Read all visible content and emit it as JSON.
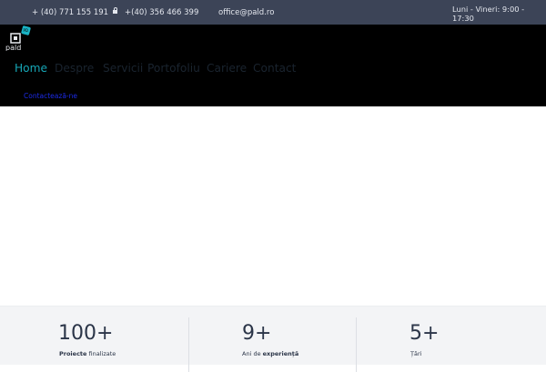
{
  "topbar": {
    "phone1": "+ (40) 771 155 191",
    "phone2": "+(40) 356 466 399",
    "email": "office@pald.ro",
    "hours": "Luni - Vineri: 9:00 - 17:30",
    "lock_icon": "lock-icon"
  },
  "logo": {
    "text": "pald",
    "icon": "chip-icon"
  },
  "nav": {
    "items": [
      {
        "label": "Home",
        "active": true
      },
      {
        "label": "Despre"
      },
      {
        "label": "Servicii"
      },
      {
        "label": "Portofoliu"
      },
      {
        "label": "Cariere"
      },
      {
        "label": "Contact"
      }
    ],
    "contact_link": "Contactează-ne"
  },
  "stats": [
    {
      "number": "100+",
      "label_bold": "Proiecte",
      "label_rest": " finalizate"
    },
    {
      "number": "9+",
      "label_pre": "Ani de ",
      "label_bold": "experiență"
    },
    {
      "number": "5+",
      "label": "Țări"
    }
  ],
  "colors": {
    "topbar_bg": "#3c4457",
    "header_bg": "#000000",
    "accent": "#16a6b6",
    "link_blue": "#1c2be8",
    "stats_bg": "#f3f4f6"
  }
}
